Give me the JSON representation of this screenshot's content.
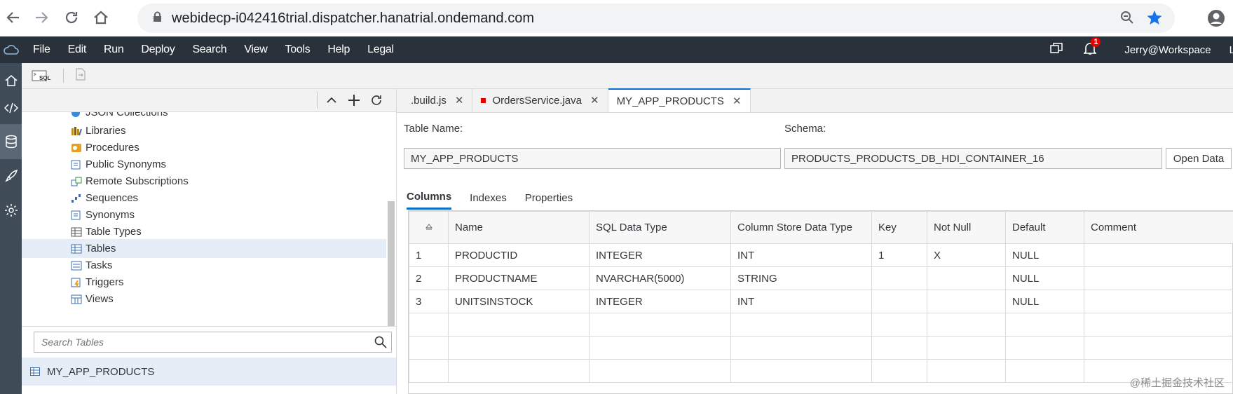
{
  "browser": {
    "url": "webidecp-i042416trial.dispatcher.hanatrial.ondemand.com"
  },
  "menu": {
    "items": [
      "File",
      "Edit",
      "Run",
      "Deploy",
      "Search",
      "View",
      "Tools",
      "Help",
      "Legal"
    ],
    "notification_count": "1",
    "user": "Jerry@Workspace",
    "cut_text": "L"
  },
  "toolbar": {
    "sql_label": "SQL"
  },
  "tree": {
    "partial_item": "JSON Collections",
    "items": [
      {
        "label": "Libraries",
        "icon": "library-icon"
      },
      {
        "label": "Procedures",
        "icon": "procedure-icon"
      },
      {
        "label": "Public Synonyms",
        "icon": "public-synonym-icon"
      },
      {
        "label": "Remote Subscriptions",
        "icon": "remote-subscription-icon"
      },
      {
        "label": "Sequences",
        "icon": "sequence-icon"
      },
      {
        "label": "Synonyms",
        "icon": "synonym-icon"
      },
      {
        "label": "Table Types",
        "icon": "table-type-icon"
      },
      {
        "label": "Tables",
        "icon": "table-icon"
      },
      {
        "label": "Tasks",
        "icon": "task-icon"
      },
      {
        "label": "Triggers",
        "icon": "trigger-icon"
      },
      {
        "label": "Views",
        "icon": "view-icon"
      }
    ],
    "selected_index": 7,
    "search_placeholder": "Search Tables",
    "result": "MY_APP_PRODUCTS"
  },
  "tabs": [
    {
      "label": ".build.js",
      "modified": false
    },
    {
      "label": "OrdersService.java",
      "modified": true
    },
    {
      "label": "MY_APP_PRODUCTS",
      "modified": false,
      "active": true
    }
  ],
  "editor": {
    "table_name_label": "Table Name:",
    "table_name": "MY_APP_PRODUCTS",
    "schema_label": "Schema:",
    "schema": "PRODUCTS_PRODUCTS_DB_HDI_CONTAINER_16",
    "open_data_label": "Open Data",
    "subtabs": [
      "Columns",
      "Indexes",
      "Properties"
    ],
    "active_subtab": 0
  },
  "grid": {
    "columns": [
      "",
      "Name",
      "SQL Data Type",
      "Column Store Data Type",
      "Key",
      "Not Null",
      "Default",
      "Comment"
    ],
    "rows": [
      [
        "1",
        "PRODUCTID",
        "INTEGER",
        "INT",
        "1",
        "X",
        "NULL",
        ""
      ],
      [
        "2",
        "PRODUCTNAME",
        "NVARCHAR(5000)",
        "STRING",
        "",
        "",
        "NULL",
        ""
      ],
      [
        "3",
        "UNITSINSTOCK",
        "INTEGER",
        "INT",
        "",
        "",
        "NULL",
        ""
      ]
    ]
  },
  "watermark": "@稀土掘金技术社区",
  "colors": {
    "menubar": "#29313a",
    "rail": "#3f4b57",
    "accent": "#0a6ed1",
    "selected_row": "#e5eef6",
    "modified_marker": "#e00000"
  }
}
